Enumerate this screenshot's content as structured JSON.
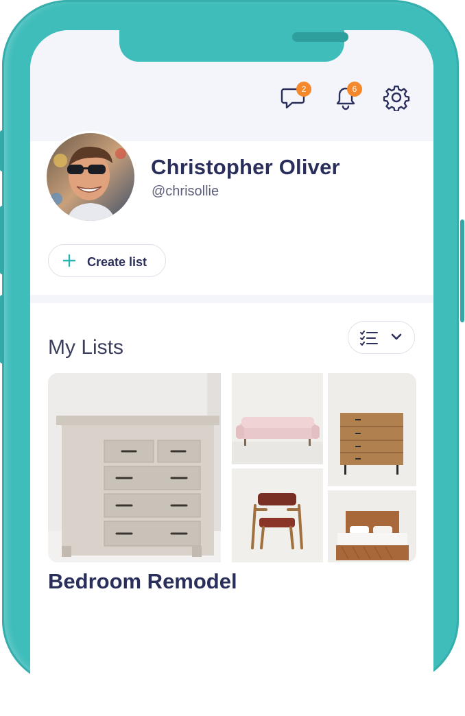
{
  "header": {
    "messages": {
      "icon": "chat-bubble-icon",
      "badge": "2"
    },
    "notifications": {
      "icon": "bell-icon",
      "badge": "6"
    },
    "settings": {
      "icon": "gear-icon"
    }
  },
  "profile": {
    "name": "Christopher Oliver",
    "handle": "@chrisollie",
    "avatar": "profile-photo"
  },
  "actions": {
    "create_list_label": "Create list"
  },
  "my_lists": {
    "title": "My Lists",
    "view_toggle": {
      "icon": "checklist-icon",
      "chevron": "chevron-down-icon"
    },
    "lists": [
      {
        "name": "Bedroom Remodel",
        "images": [
          "whitewashed-dresser",
          "pink-sofa",
          "wooden-dresser",
          "velvet-chair",
          "wooden-bed"
        ]
      }
    ]
  },
  "colors": {
    "frame": "#3fbdbb",
    "badge": "#f5882a",
    "text_dark": "#2a2e5a",
    "accent": "#2bb5b1",
    "surface": "#f3f5fb"
  }
}
